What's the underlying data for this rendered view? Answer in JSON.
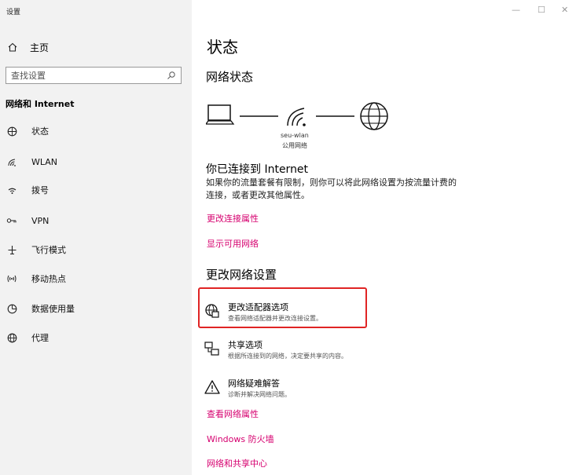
{
  "window": {
    "title": "设置",
    "controls": [
      "—",
      "☐",
      "✕"
    ]
  },
  "sidebar": {
    "home_label": "主页",
    "search_placeholder": "查找设置",
    "section_title": "网络和 Internet",
    "items": [
      {
        "label": "状态",
        "icon": "status-icon"
      },
      {
        "label": "WLAN",
        "icon": "wifi-icon"
      },
      {
        "label": "拨号",
        "icon": "dialup-icon"
      },
      {
        "label": "VPN",
        "icon": "vpn-icon"
      },
      {
        "label": "飞行模式",
        "icon": "airplane-icon"
      },
      {
        "label": "移动热点",
        "icon": "hotspot-icon"
      },
      {
        "label": "数据使用量",
        "icon": "data-usage-icon"
      },
      {
        "label": "代理",
        "icon": "proxy-icon"
      }
    ]
  },
  "main": {
    "page_title": "状态",
    "network_status_heading": "网络状态",
    "network": {
      "ssid": "seu-wlan",
      "type": "公用网络"
    },
    "connected_title": "你已连接到 Internet",
    "connected_desc": "如果你的流量套餐有限制，则你可以将此网络设置为按流量计费的连接，或者更改其他属性。",
    "links_top": [
      "更改连接属性",
      "显示可用网络"
    ],
    "change_settings_heading": "更改网络设置",
    "options": [
      {
        "title": "更改适配器选项",
        "desc": "查看网络适配器并更改连接设置。",
        "icon": "adapter-icon"
      },
      {
        "title": "共享选项",
        "desc": "根据所连接到的网络，决定要共享的内容。",
        "icon": "sharing-icon"
      },
      {
        "title": "网络疑难解答",
        "desc": "诊断并解决网络问题。",
        "icon": "warning-icon"
      }
    ],
    "links_bottom": [
      "查看网络属性",
      "Windows 防火墙",
      "网络和共享中心"
    ]
  },
  "colors": {
    "accent_link": "#d6006f",
    "highlight_border": "#e02424",
    "sidebar_bg": "#f2f2f2"
  }
}
